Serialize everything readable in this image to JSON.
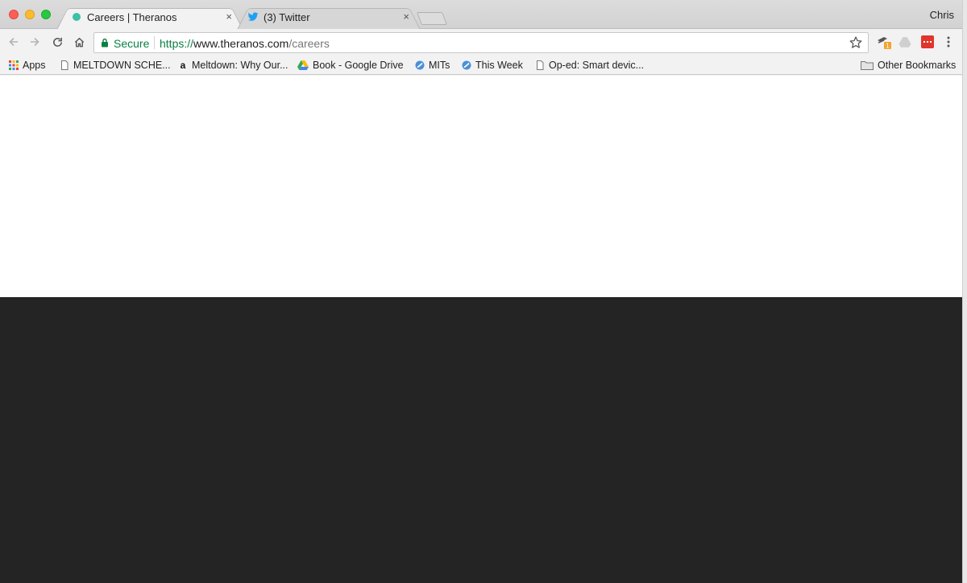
{
  "window": {
    "profile_name": "Chris",
    "tabs": [
      {
        "title": "Careers | Theranos",
        "active": true,
        "favicon": "theranos-favicon-icon",
        "close": "×"
      },
      {
        "title": "(3) Twitter",
        "active": false,
        "favicon": "twitter-bird-icon",
        "close": "×"
      }
    ]
  },
  "toolbar": {
    "security_label": "Secure",
    "url": {
      "scheme": "https://",
      "host": "www.theranos.com",
      "path": "/careers"
    },
    "extensions": [
      "extension-badge-icon",
      "google-drive-extension-icon",
      "red-extension-icon"
    ],
    "extension_badge_count": "1"
  },
  "bookmarks": {
    "items": [
      {
        "label": "Apps",
        "icon": "apps-grid-icon"
      },
      {
        "label": "MELTDOWN SCHE...",
        "icon": "page-icon"
      },
      {
        "label": "Meltdown: Why Our...",
        "icon": "amazon-icon"
      },
      {
        "label": "Book - Google Drive",
        "icon": "google-drive-icon"
      },
      {
        "label": "MITs",
        "icon": "blue-circle-icon"
      },
      {
        "label": "This Week",
        "icon": "blue-circle-icon"
      },
      {
        "label": "Op-ed: Smart devic...",
        "icon": "page-icon"
      }
    ],
    "other": "Other Bookmarks"
  },
  "colors": {
    "secure_green": "#0b8043",
    "page_top": "#ffffff",
    "page_bottom": "#242424"
  }
}
